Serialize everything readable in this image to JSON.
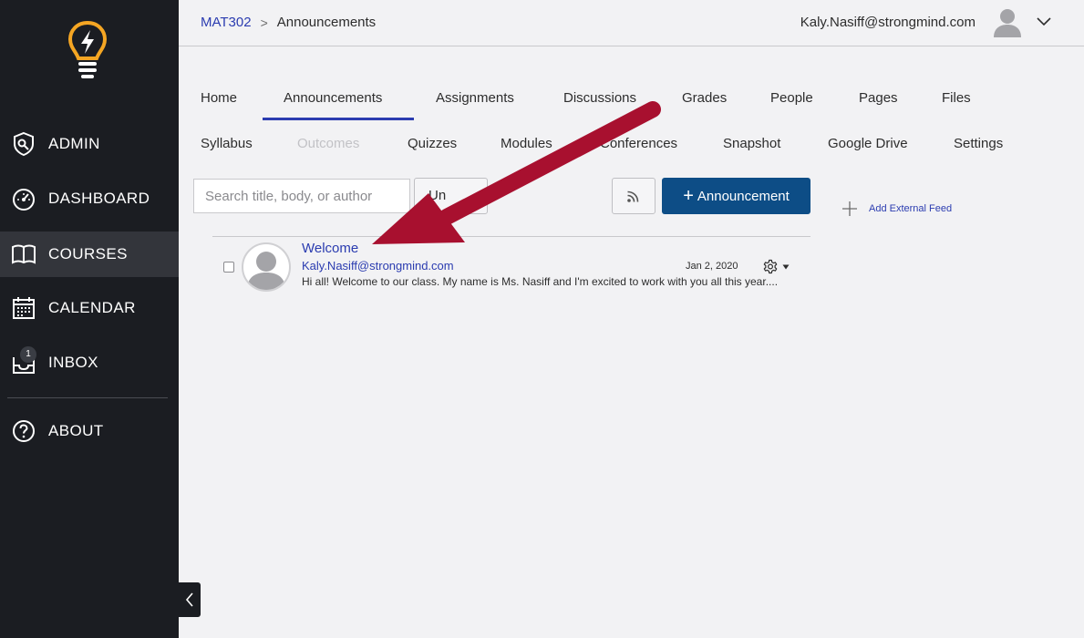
{
  "sidebar": {
    "items": [
      {
        "label": "ADMIN",
        "icon": "admin-shield-icon"
      },
      {
        "label": "DASHBOARD",
        "icon": "dashboard-gauge-icon"
      },
      {
        "label": "COURSES",
        "icon": "book-icon"
      },
      {
        "label": "CALENDAR",
        "icon": "calendar-icon"
      },
      {
        "label": "INBOX",
        "icon": "inbox-icon",
        "badge": "1"
      },
      {
        "label": "ABOUT",
        "icon": "question-icon"
      }
    ],
    "active": "COURSES"
  },
  "header": {
    "breadcrumb": {
      "course": "MAT302",
      "separator": ">",
      "current": "Announcements"
    },
    "user_email": "Kaly.Nasiff@strongmind.com"
  },
  "tabs": {
    "row1": [
      "Home",
      "Announcements",
      "Assignments",
      "Discussions",
      "Grades",
      "People",
      "Pages",
      "Files"
    ],
    "row2": [
      "Syllabus",
      "Outcomes",
      "Quizzes",
      "Modules",
      "Conferences",
      "Snapshot",
      "Google Drive",
      "Settings"
    ],
    "active": "Announcements",
    "disabled": [
      "Outcomes"
    ]
  },
  "toolbar": {
    "search_placeholder": "Search title, body, or author",
    "filter_label": "Un",
    "new_announcement_label": "Announcement",
    "external_feed_label": "Add External Feed"
  },
  "announcements": [
    {
      "title": "Welcome",
      "author": "Kaly.Nasiff@strongmind.com",
      "date": "Jan 2, 2020",
      "excerpt": "Hi all! Welcome to our class. My name is Ms. Nasiff and I'm excited to work with you all this year...."
    }
  ],
  "colors": {
    "sidebar_bg": "#1b1d22",
    "accent": "#2b3cb0",
    "primary_button": "#0d4d86",
    "logo": "#f5a623",
    "arrow": "#a8102f"
  }
}
